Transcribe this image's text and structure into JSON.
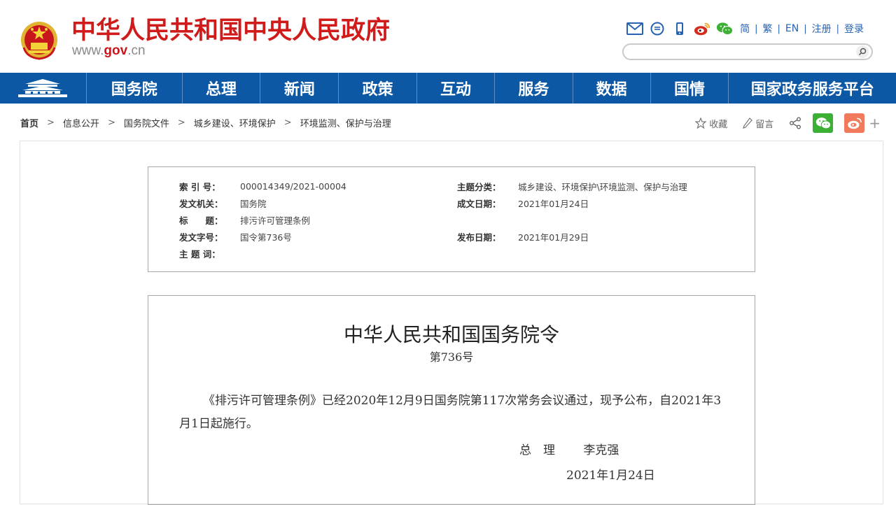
{
  "header": {
    "site_title": "中华人民共和国中央人民政府",
    "site_url_prefix": "www.",
    "site_url_domain": "gov",
    "site_url_suffix": ".cn",
    "tools": [
      "mail-icon",
      "chat-icon",
      "mobile-icon",
      "weibo-icon",
      "wechat-icon"
    ],
    "lang": {
      "simplified": "简",
      "traditional": "繁",
      "english": "EN",
      "register": "注册",
      "login": "登录"
    },
    "search_placeholder": ""
  },
  "nav": {
    "items": [
      "国务院",
      "总理",
      "新闻",
      "政策",
      "互动",
      "服务",
      "数据",
      "国情",
      "国家政务服务平台"
    ]
  },
  "breadcrumb": {
    "items": [
      "首页",
      "信息公开",
      "国务院文件",
      "城乡建设、环境保护",
      "环境监测、保护与治理"
    ]
  },
  "share": {
    "favorite": "收藏",
    "comment": "留言",
    "plus": "+"
  },
  "meta": {
    "index_label": "索 引 号：",
    "index_value": "000014349/2021-00004",
    "topic_label": "主题分类：",
    "topic_value": "城乡建设、环境保护\\环境监测、保护与治理",
    "issuer_label": "发文机关：",
    "issuer_value": "国务院",
    "written_label": "成文日期：",
    "written_value": "2021年01月24日",
    "title_label": "标　　题：",
    "title_value": "排污许可管理条例",
    "docno_label": "发文字号：",
    "docno_value": "国令第736号",
    "published_label": "发布日期：",
    "published_value": "2021年01月29日",
    "keywords_label": "主 题 词：",
    "keywords_value": ""
  },
  "document": {
    "title": "中华人民共和国国务院令",
    "number": "第736号",
    "body": "《排污许可管理条例》已经2020年12月9日国务院第117次常务会议通过，现予公布，自2021年3月1日起施行。",
    "sign_role": "总理",
    "sign_name": "李克强",
    "date": "2021年1月24日"
  },
  "colors": {
    "brand_red": "#d01b1b",
    "nav_blue": "#0c58a5",
    "link_blue": "#2763b2",
    "wechat_green": "#3cb034",
    "weibo_orange": "#f07a5b"
  }
}
